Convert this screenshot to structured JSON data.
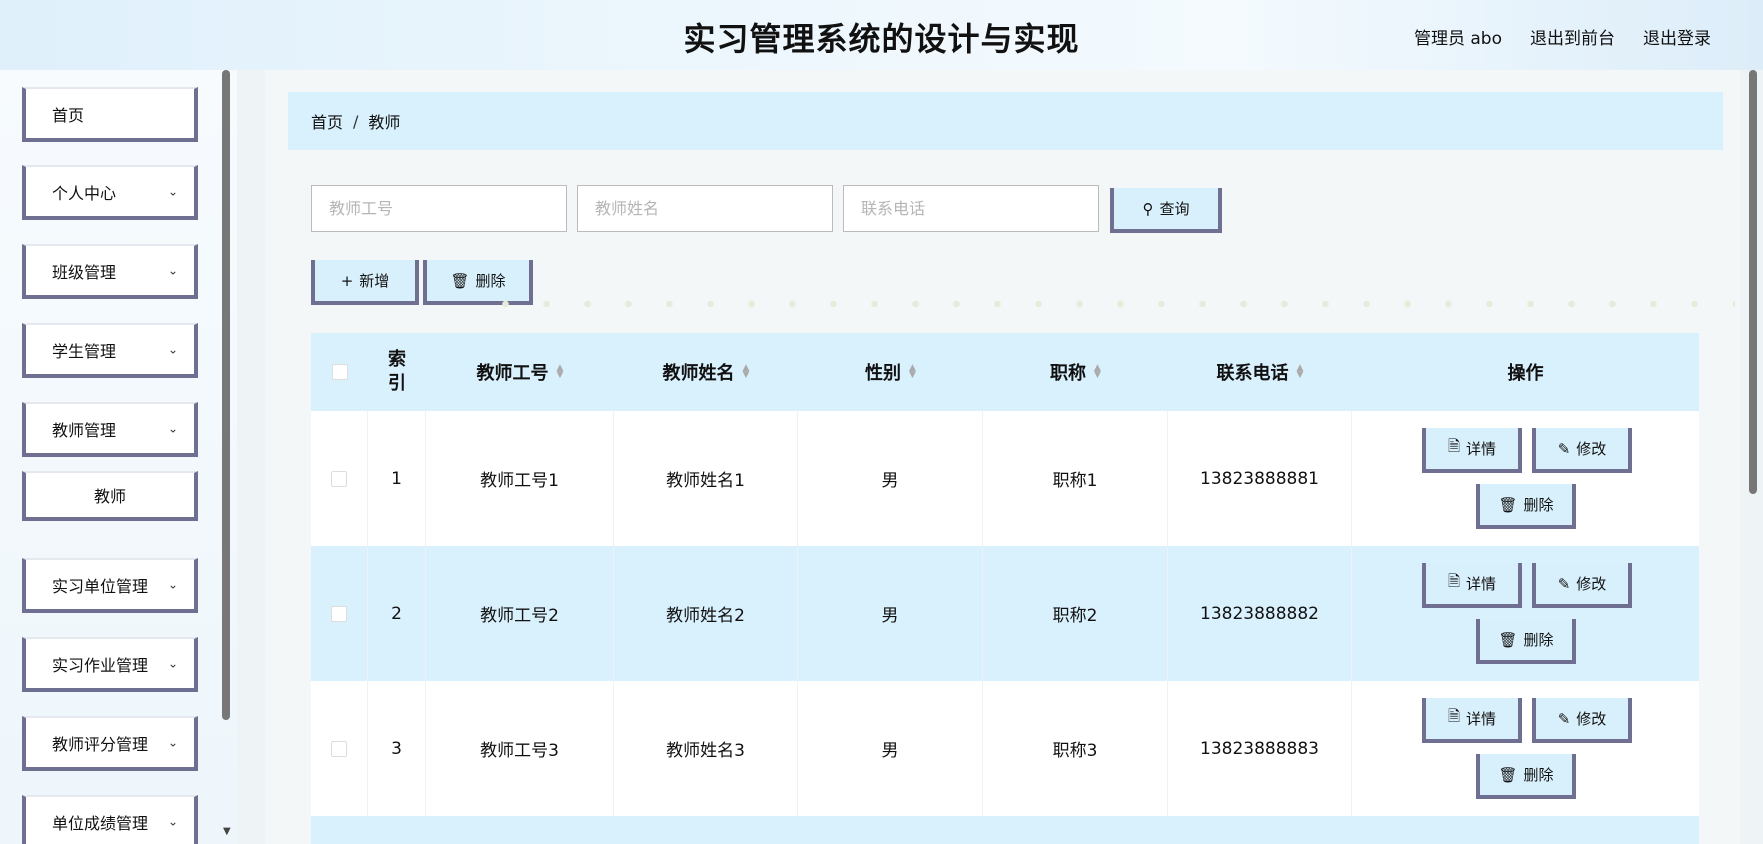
{
  "header": {
    "title": "实习管理系统的设计与实现",
    "user": "管理员 abo",
    "front_link": "退出到前台",
    "logout_link": "退出登录"
  },
  "sidebar": {
    "items": [
      {
        "label": "首页",
        "has_arrow": false
      },
      {
        "label": "个人中心",
        "has_arrow": true
      },
      {
        "label": "班级管理",
        "has_arrow": true
      },
      {
        "label": "学生管理",
        "has_arrow": true
      },
      {
        "label": "教师管理",
        "has_arrow": true
      },
      {
        "label": "教师",
        "has_arrow": false,
        "sub": true
      },
      {
        "label": "实习单位管理",
        "has_arrow": true
      },
      {
        "label": "实习作业管理",
        "has_arrow": true
      },
      {
        "label": "教师评分管理",
        "has_arrow": true
      },
      {
        "label": "单位成绩管理",
        "has_arrow": true
      }
    ]
  },
  "breadcrumb": {
    "home": "首页",
    "sep": "/",
    "current": "教师"
  },
  "search": {
    "teacher_no_placeholder": "教师工号",
    "teacher_name_placeholder": "教师姓名",
    "phone_placeholder": "联系电话",
    "query_label": "查询"
  },
  "actions": {
    "add_label": "新增",
    "delete_label": "删除"
  },
  "table": {
    "columns": {
      "index": "索引",
      "teacher_no": "教师工号",
      "teacher_name": "教师姓名",
      "gender": "性别",
      "title": "职称",
      "phone": "联系电话",
      "ops": "操作"
    },
    "rows": [
      {
        "index": "1",
        "teacher_no": "教师工号1",
        "teacher_name": "教师姓名1",
        "gender": "男",
        "title": "职称1",
        "phone": "13823888881"
      },
      {
        "index": "2",
        "teacher_no": "教师工号2",
        "teacher_name": "教师姓名2",
        "gender": "男",
        "title": "职称2",
        "phone": "13823888882"
      },
      {
        "index": "3",
        "teacher_no": "教师工号3",
        "teacher_name": "教师姓名3",
        "gender": "男",
        "title": "职称3",
        "phone": "13823888883"
      }
    ],
    "op_labels": {
      "detail": "详情",
      "edit": "修改",
      "delete": "删除"
    }
  },
  "colors": {
    "accent_border": "#6f6f92",
    "light_blue": "#d9f0fd"
  }
}
